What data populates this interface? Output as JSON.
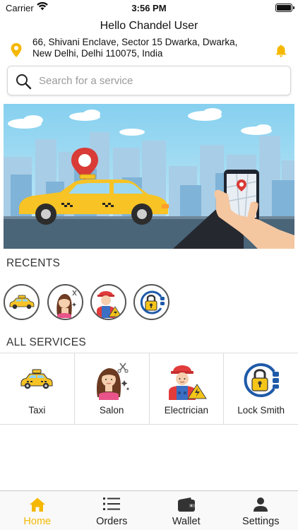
{
  "status_bar": {
    "carrier": "Carrier",
    "time": "3:56 PM"
  },
  "header": {
    "greeting": "Hello Chandel User",
    "address": "66, Shivani Enclave, Sector 15 Dwarka, Dwarka, New Delhi, Delhi 110075, India"
  },
  "search": {
    "placeholder": "Search for a service",
    "value": ""
  },
  "recents": {
    "title": "RECENTS",
    "items": [
      {
        "service": "Taxi",
        "icon": "taxi-icon"
      },
      {
        "service": "Salon",
        "icon": "salon-icon"
      },
      {
        "service": "Electrician",
        "icon": "electrician-icon"
      },
      {
        "service": "Lock Smith",
        "icon": "lock-smith-icon"
      }
    ]
  },
  "all_services": {
    "title": "ALL SERVICES",
    "items": [
      {
        "label": "Taxi",
        "icon": "taxi-icon"
      },
      {
        "label": "Salon",
        "icon": "salon-icon"
      },
      {
        "label": "Electrician",
        "icon": "electrician-icon"
      },
      {
        "label": "Lock Smith",
        "icon": "lock-smith-icon"
      }
    ]
  },
  "tab_bar": {
    "tabs": [
      {
        "label": "Home",
        "icon": "home-icon",
        "active": true
      },
      {
        "label": "Orders",
        "icon": "list-icon",
        "active": false
      },
      {
        "label": "Wallet",
        "icon": "wallet-icon",
        "active": false
      },
      {
        "label": "Settings",
        "icon": "person-icon",
        "active": false
      }
    ]
  },
  "colors": {
    "accent": "#f5b800",
    "taxi_yellow": "#f7c325",
    "sky": "#8fd3ef",
    "lock_blue": "#1e5aa8"
  }
}
